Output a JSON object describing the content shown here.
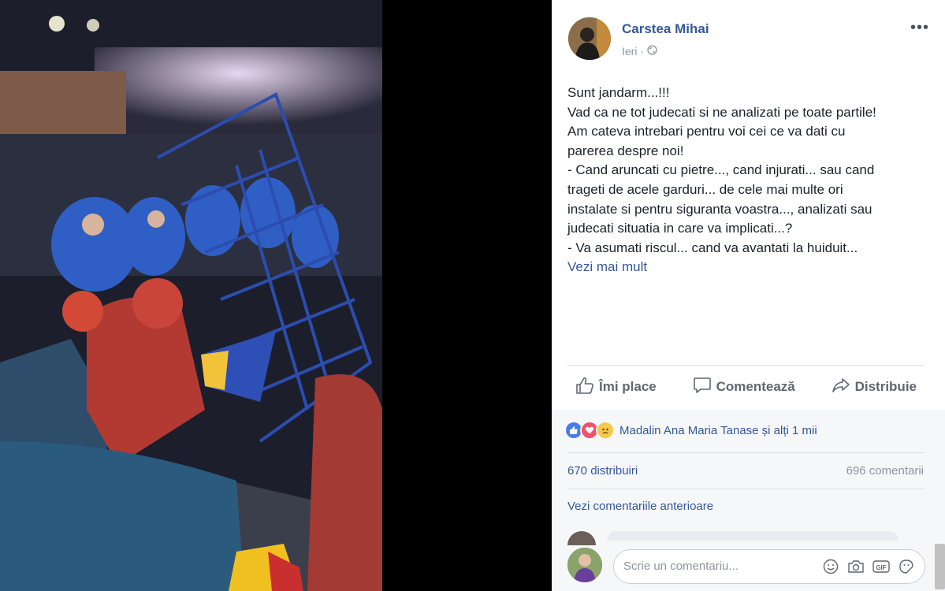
{
  "post": {
    "author": "Carstea Mihai",
    "time": "Ieri",
    "separator": "·",
    "text_lines": [
      "Sunt jandarm...!!!",
      "Vad ca ne tot judecati si ne analizati pe toate partile!",
      "Am cateva intrebari pentru voi cei ce va dati cu",
      "parerea despre noi!",
      "- Cand aruncati cu pietre..., cand injurati... sau cand",
      "trageti de acele garduri... de cele mai multe ori",
      "instalate si pentru siguranta voastra..., analizati sau",
      "judecati situatia in care va implicati...?",
      "- Va asumati riscul... cand va avantati la huiduit..."
    ],
    "see_more": "Vezi mai mult"
  },
  "actions": {
    "like": "Îmi place",
    "comment": "Comentează",
    "share": "Distribuie"
  },
  "reactions": {
    "text": "Madalin Ana Maria Tanase și alți 1 mii",
    "icons": [
      "like-reaction",
      "love-reaction",
      "sad-reaction"
    ],
    "colors": {
      "like": "#4a7bea",
      "love": "#f25268",
      "sad": "#f7c94a"
    }
  },
  "stats": {
    "shares": "670 distribuiri",
    "comments": "696 comentarii"
  },
  "comments": {
    "previous_link": "Vezi comentariile anterioare",
    "placeholder": "Scrie un comentariu..."
  },
  "colors": {
    "link": "#365899",
    "muted": "#90949c",
    "text": "#1d2129"
  }
}
